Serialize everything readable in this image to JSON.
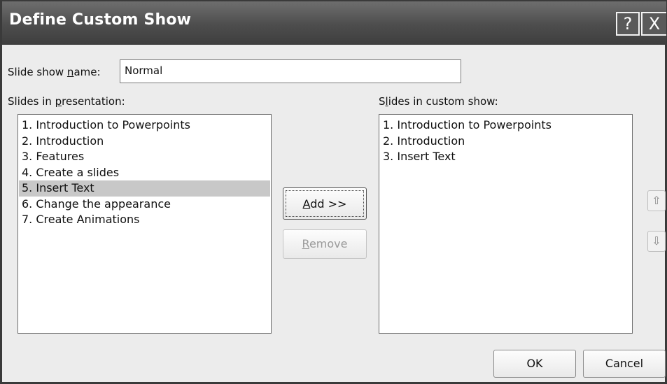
{
  "window": {
    "title": "Define Custom Show",
    "help_icon": "?",
    "close_icon": "X"
  },
  "name_field": {
    "label_pre": "Slide show ",
    "label_u": "n",
    "label_post": "ame:",
    "value": "Normal"
  },
  "left_list": {
    "label_pre": "Slides in ",
    "label_u": "p",
    "label_post": "resentation:",
    "items": [
      "1. Introduction to Powerpoints",
      "2. Introduction",
      "3. Features",
      "4. Create a slides",
      "5. Insert Text",
      "6. Change the appearance",
      "7. Create Animations"
    ],
    "selected_index": 4
  },
  "right_list": {
    "label_pre": "S",
    "label_u": "l",
    "label_post": "ides in custom show:",
    "items": [
      "1. Introduction to Powerpoints",
      "2. Introduction",
      "3. Insert Text"
    ]
  },
  "buttons": {
    "add_u": "A",
    "add_rest": "dd >>",
    "remove_u": "R",
    "remove_rest": "emove",
    "ok": "OK",
    "cancel": "Cancel"
  },
  "icons": {
    "up": "up-arrow-icon",
    "down": "down-arrow-icon"
  }
}
